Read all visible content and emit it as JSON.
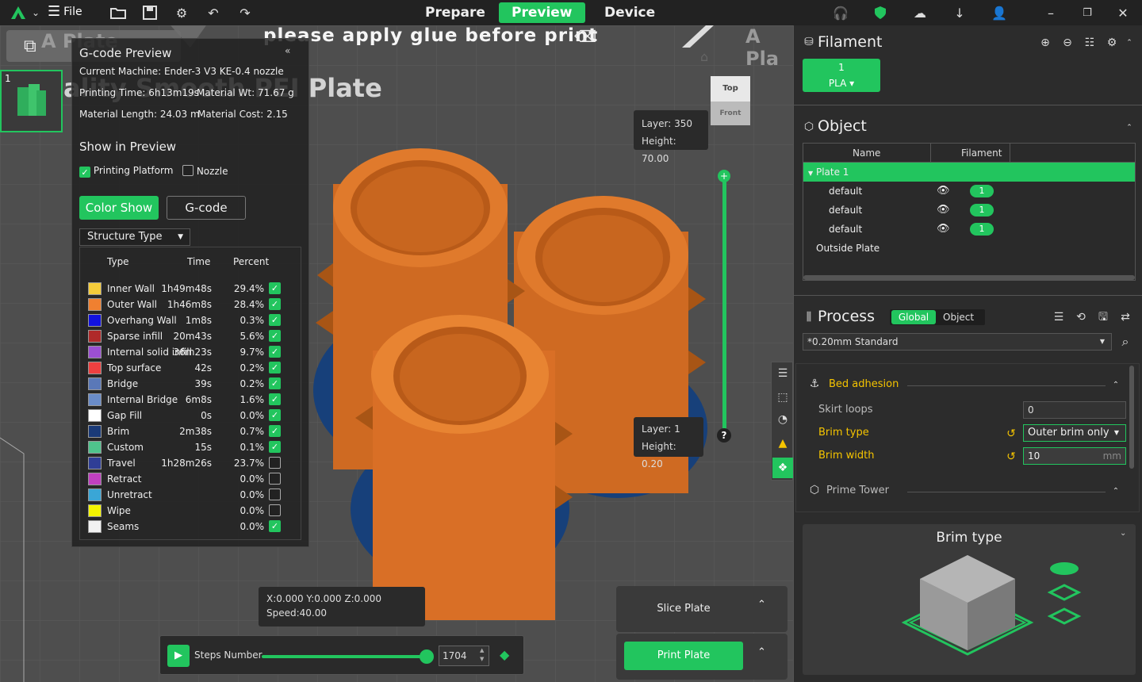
{
  "topbar": {
    "file_label": "File",
    "tabs": [
      "Prepare",
      "Preview",
      "Device"
    ],
    "active_tab": "Preview"
  },
  "viewport": {
    "plate_text_left": "A Plate",
    "plate_text_right": "A Pla",
    "glue_notice": "please apply glue before print",
    "plate_surface_text": "ality Smooth PEI Plate",
    "plate_number": "1",
    "view_top": "Top",
    "view_front": "Front",
    "layer_top": {
      "layer": "Layer: 350",
      "height": "Height: 70.00"
    },
    "layer_bottom": {
      "layer": "Layer: 1",
      "height": "Height: 0.20"
    },
    "help": "?",
    "coords": "X:0.000  Y:0.000  Z:0.000",
    "speed": "Speed:40.00",
    "steps_label": "Steps Number",
    "steps_value": "1704",
    "slice_plate": "Slice Plate",
    "print_plate": "Print Plate"
  },
  "gcode_panel": {
    "title": "G-code Preview",
    "machine": "Current Machine: Ender-3 V3 KE-0.4 nozzle",
    "printing_time": "Printing Time: 6h13m19s",
    "material_wt": "Material Wt: 71.67 g",
    "material_length": "Material Length: 24.03 m",
    "material_cost": "Material Cost: 2.15",
    "show_title": "Show in Preview",
    "opt_platform": "Printing Platform",
    "opt_nozzle": "Nozzle",
    "btn_color_show": "Color Show",
    "btn_gcode": "G-code",
    "structure_select": "Structure Type",
    "col_type": "Type",
    "col_time": "Time",
    "col_percent": "Percent",
    "legend": [
      {
        "name": "Inner Wall",
        "time": "1h49m48s",
        "pct": "29.4%",
        "color": "#f5cc3a",
        "on": true
      },
      {
        "name": "Outer Wall",
        "time": "1h46m8s",
        "pct": "28.4%",
        "color": "#f08030",
        "on": true
      },
      {
        "name": "Overhang Wall",
        "time": "1m8s",
        "pct": "0.3%",
        "color": "#1212e0",
        "on": true
      },
      {
        "name": "Sparse infill",
        "time": "20m43s",
        "pct": "5.6%",
        "color": "#b02a2a",
        "on": true
      },
      {
        "name": "Internal solid infill",
        "time": "36m23s",
        "pct": "9.7%",
        "color": "#9b4fd3",
        "on": true
      },
      {
        "name": "Top surface",
        "time": "42s",
        "pct": "0.2%",
        "color": "#ee4040",
        "on": true
      },
      {
        "name": "Bridge",
        "time": "39s",
        "pct": "0.2%",
        "color": "#5a78b8",
        "on": true
      },
      {
        "name": "Internal Bridge",
        "time": "6m8s",
        "pct": "1.6%",
        "color": "#6a8cc8",
        "on": true
      },
      {
        "name": "Gap Fill",
        "time": "0s",
        "pct": "0.0%",
        "color": "#ffffff",
        "on": true
      },
      {
        "name": "Brim",
        "time": "2m38s",
        "pct": "0.7%",
        "color": "#1a3a78",
        "on": true
      },
      {
        "name": "Custom",
        "time": "15s",
        "pct": "0.1%",
        "color": "#4fc38c",
        "on": true
      },
      {
        "name": "Travel",
        "time": "1h28m26s",
        "pct": "23.7%",
        "color": "#2f3e96",
        "on": false
      },
      {
        "name": "Retract",
        "time": "",
        "pct": "0.0%",
        "color": "#c040c0",
        "on": false
      },
      {
        "name": "Unretract",
        "time": "",
        "pct": "0.0%",
        "color": "#3aa6d6",
        "on": false
      },
      {
        "name": "Wipe",
        "time": "",
        "pct": "0.0%",
        "color": "#f5f500",
        "on": false
      },
      {
        "name": "Seams",
        "time": "",
        "pct": "0.0%",
        "color": "#f2f2f2",
        "on": true
      }
    ]
  },
  "right_panel": {
    "filament_title": "Filament",
    "filament_num": "1",
    "filament_type": "PLA",
    "object_title": "Object",
    "col_name": "Name",
    "col_filament": "Filament",
    "plate_row": "Plate 1",
    "objects": [
      {
        "name": "default",
        "filament": "1"
      },
      {
        "name": "default",
        "filament": "1"
      },
      {
        "name": "default",
        "filament": "1"
      }
    ],
    "outside_plate": "Outside Plate",
    "process_title": "Process",
    "process_global": "Global",
    "process_object": "Object",
    "preset": "*0.20mm Standard",
    "bed_adhesion": "Bed adhesion",
    "skirt_loops_label": "Skirt loops",
    "skirt_loops_value": "0",
    "brim_type_label": "Brim type",
    "brim_type_value": "Outer brim only",
    "brim_width_label": "Brim width",
    "brim_width_value": "10",
    "brim_width_unit": "mm",
    "prime_tower": "Prime Tower",
    "help_title": "Brim type",
    "accent": "#22c55e",
    "highlight": "#f5c400"
  }
}
